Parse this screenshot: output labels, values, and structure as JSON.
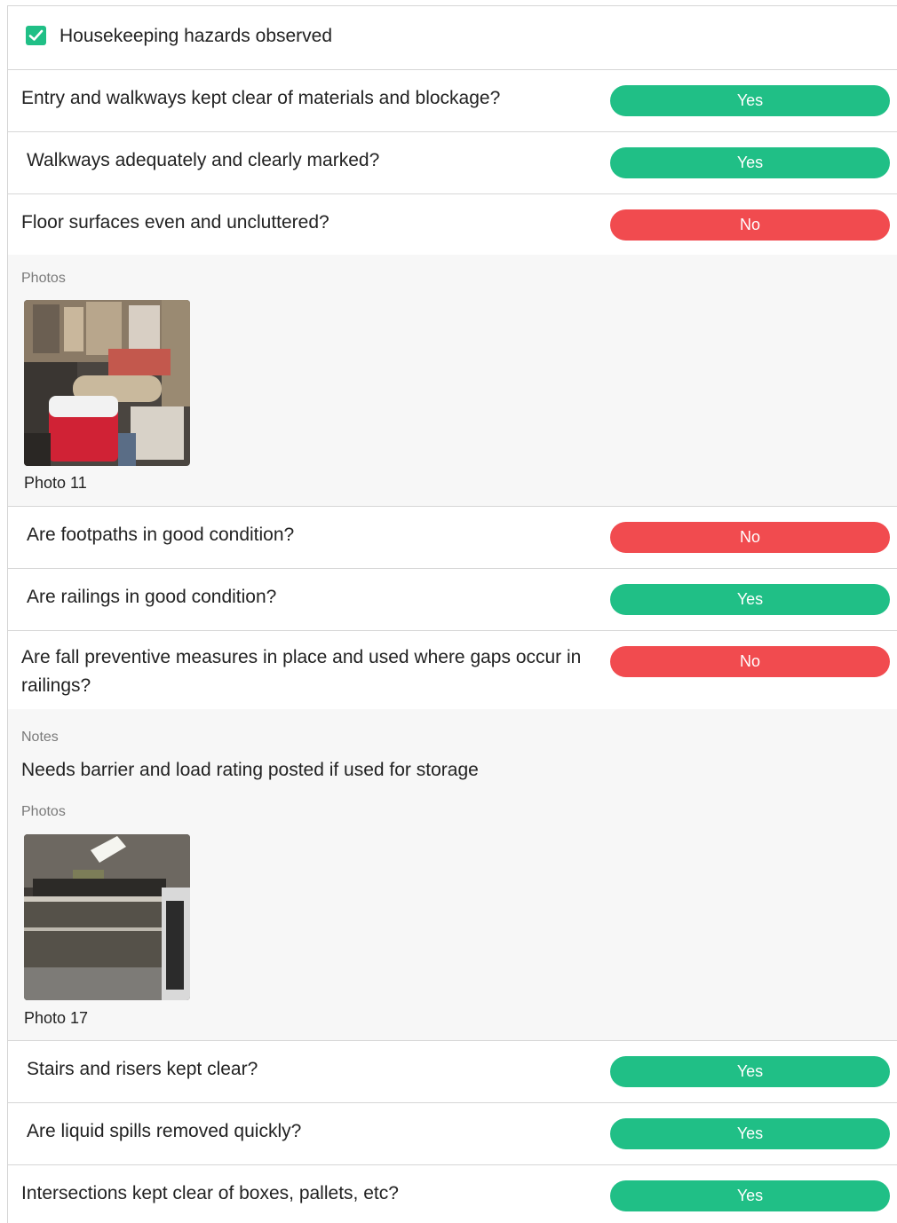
{
  "section": {
    "title": "Housekeeping hazards observed",
    "checked": true,
    "accent_color": "#20bf86"
  },
  "answer_colors": {
    "yes": "#20bf86",
    "no": "#f14b4f"
  },
  "questions": [
    {
      "text": "Entry and walkways kept clear of materials and blockage?",
      "answer": "Yes"
    },
    {
      "text": "Walkways adequately and clearly marked?",
      "answer": "Yes"
    },
    {
      "text": "Floor surfaces even and uncluttered?",
      "answer": "No",
      "photos_label": "Photos",
      "photo_caption": "Photo 11"
    },
    {
      "text": "Are footpaths in good condition?",
      "answer": "No"
    },
    {
      "text": "Are railings in good condition?",
      "answer": "Yes"
    },
    {
      "text": "Are fall preventive measures in place and used where gaps occur in railings?",
      "answer": "No",
      "notes_label": "Notes",
      "notes": "Needs barrier and load rating posted if used for storage",
      "photos_label": "Photos",
      "photo_caption": "Photo 17"
    },
    {
      "text": "Stairs and risers kept clear?",
      "answer": "Yes"
    },
    {
      "text": "Are liquid spills removed quickly?",
      "answer": "Yes"
    },
    {
      "text": "Intersections kept clear of boxes, pallets, etc?",
      "answer": "Yes"
    }
  ]
}
